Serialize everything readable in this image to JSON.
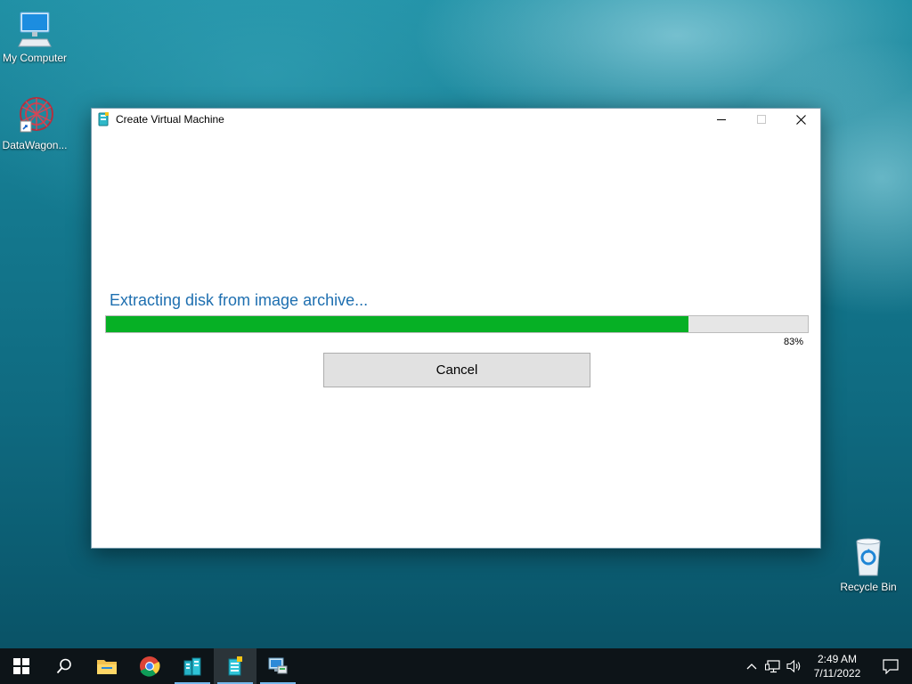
{
  "desktop": {
    "icons": [
      {
        "label": "My Computer",
        "icon": "computer-icon"
      },
      {
        "label": "DataWagon...",
        "icon": "datawagon-icon"
      },
      {
        "label": "Recycle Bin",
        "icon": "recycle-bin-icon"
      }
    ]
  },
  "window": {
    "title": "Create Virtual Machine",
    "status_text": "Extracting disk from image archive...",
    "progress_percent": 83,
    "progress_label": "83%",
    "cancel_label": "Cancel",
    "progress_color": "#06b025",
    "status_color": "#1e6fb0"
  },
  "taskbar": {
    "buttons": [
      {
        "icon": "windows-start-icon"
      },
      {
        "icon": "search-icon"
      },
      {
        "icon": "file-explorer-icon"
      },
      {
        "icon": "chrome-icon"
      },
      {
        "icon": "server-manager-icon",
        "running": true
      },
      {
        "icon": "create-vm-app-icon",
        "running": true,
        "active": true
      },
      {
        "icon": "remote-desktop-icon",
        "running": true
      }
    ],
    "tray": {
      "time": "2:49 AM",
      "date": "7/11/2022"
    }
  }
}
